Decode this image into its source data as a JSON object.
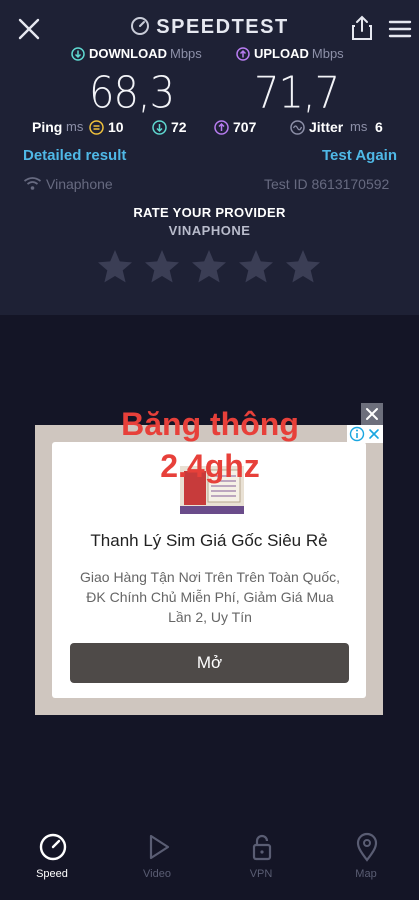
{
  "header": {
    "brand": "SPEEDTEST"
  },
  "download": {
    "label": "DOWNLOAD",
    "unit": "Mbps",
    "value": "68,3"
  },
  "upload": {
    "label": "UPLOAD",
    "unit": "Mbps",
    "value": "71,7"
  },
  "ping": {
    "label": "Ping",
    "unit": "ms",
    "idle": "10",
    "down": "72",
    "up": "707"
  },
  "jitter": {
    "label": "Jitter",
    "unit": "ms",
    "value": "6"
  },
  "links": {
    "detailed": "Detailed result",
    "again": "Test Again"
  },
  "provider": {
    "name": "Vinaphone",
    "test_id": "Test ID 8613170592"
  },
  "rating": {
    "title": "RATE YOUR PROVIDER",
    "provider": "VINAPHONE",
    "stars_filled": 0,
    "stars_total": 5
  },
  "ad": {
    "overlay_line1": "Băng thông",
    "overlay_line2": "2.4ghz",
    "title": "Thanh Lý Sim Giá Gốc Siêu Rẻ",
    "desc_line1": "Giao Hàng Tận Nơi Trên Trên Toàn Quốc,",
    "desc_line2": "ĐK Chính Chủ Miễn Phí, Giảm Giá Mua",
    "desc_line3": "Lần 2, Uy Tín",
    "cta": "Mở"
  },
  "tabs": [
    {
      "label": "Speed",
      "active": true
    },
    {
      "label": "Video",
      "active": false
    },
    {
      "label": "VPN",
      "active": false
    },
    {
      "label": "Map",
      "active": false
    }
  ],
  "colors": {
    "bg": "#141526",
    "panel": "#1e2135",
    "accent": "#4fb8e6",
    "download": "#5fd8d0",
    "upload": "#b77cf0"
  }
}
